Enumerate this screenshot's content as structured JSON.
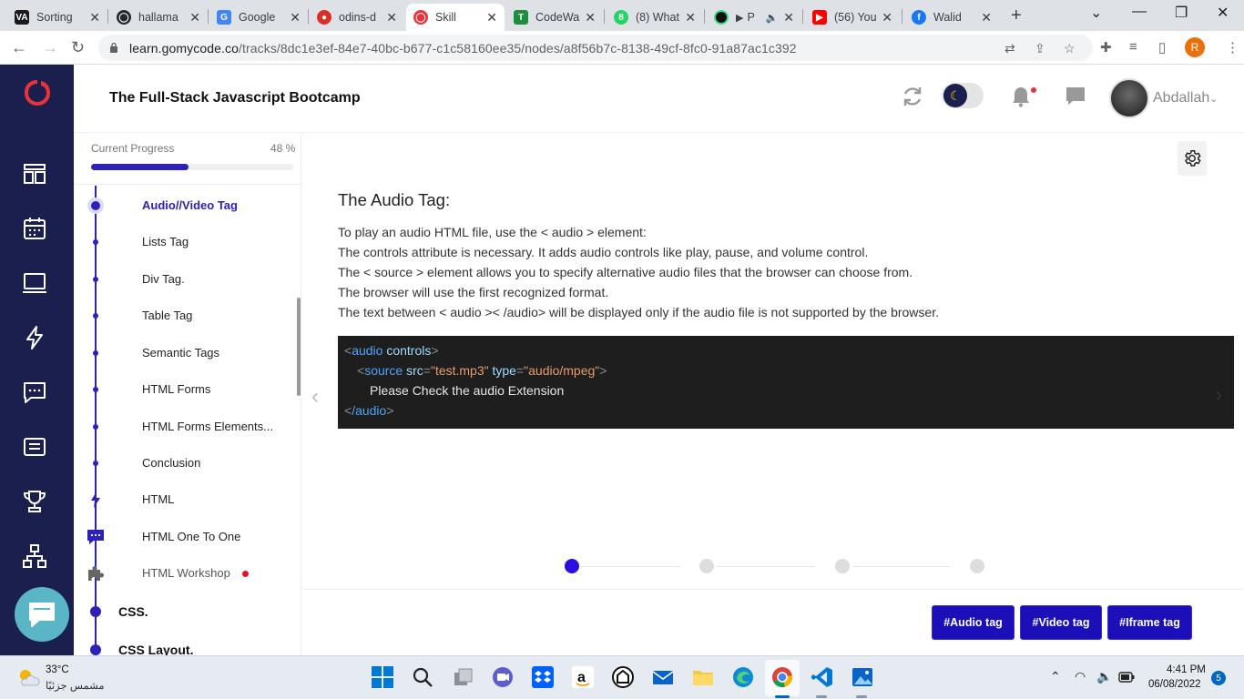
{
  "browser": {
    "tabs": [
      {
        "title": "Sorting",
        "favicon_color": "#1a1a1a",
        "favicon_glyph": "VA",
        "active": false
      },
      {
        "title": "hallama",
        "favicon_color": "#24292f",
        "favicon_glyph": "◯",
        "active": false
      },
      {
        "title": "Google",
        "favicon_color": "#4285f4",
        "favicon_glyph": "G",
        "active": false
      },
      {
        "title": "odins-d",
        "favicon_color": "#d93025",
        "favicon_glyph": "●",
        "active": false
      },
      {
        "title": "Skill",
        "favicon_color": "#e8333a",
        "favicon_glyph": "◯",
        "active": true
      },
      {
        "title": "CodeWa",
        "favicon_color": "#1e8e3e",
        "favicon_glyph": "T",
        "active": false
      },
      {
        "title": "(8) What",
        "favicon_color": "#25d366",
        "favicon_glyph": "8",
        "active": false
      },
      {
        "title": "P",
        "favicon_color": "#111111",
        "favicon_glyph": "●",
        "active": false
      },
      {
        "title": "(56) You",
        "favicon_color": "#ff0000",
        "favicon_glyph": "▶",
        "active": false
      },
      {
        "title": "Walid",
        "favicon_color": "#1877f2",
        "favicon_glyph": "f",
        "active": false
      }
    ],
    "url_host": "learn.gomycode.co",
    "url_path": "/tracks/8dc1e3ef-84e7-40bc-b677-c1c58160ee35/nodes/a8f56b7c-8138-49cf-8fc0-91a87ac1c392",
    "profile_initial": "R"
  },
  "header": {
    "title": "The Full-Stack Javascript Bootcamp",
    "username": "Abdallah"
  },
  "progress": {
    "label": "Current Progress",
    "value_text": "48 %",
    "value": 0.48
  },
  "lessons": [
    {
      "label": "Audio//Video Tag",
      "active": true
    },
    {
      "label": "Lists Tag"
    },
    {
      "label": "Div Tag."
    },
    {
      "label": "Table Tag"
    },
    {
      "label": "Semantic Tags"
    },
    {
      "label": "HTML Forms"
    },
    {
      "label": "HTML Forms Elements..."
    },
    {
      "label": "Conclusion"
    },
    {
      "label": "HTML",
      "icon": "lightning-icon"
    },
    {
      "label": "HTML One To One",
      "icon": "chat-icon"
    },
    {
      "label": "HTML Workshop",
      "icon": "puzzle-icon",
      "badge": true
    }
  ],
  "sections": [
    {
      "label": "CSS."
    },
    {
      "label": "CSS Layout."
    }
  ],
  "content": {
    "heading": "The Audio Tag:",
    "paragraphs": [
      "To play an audio HTML file, use the < audio > element:",
      "The controls attribute is necessary. It adds audio controls like play, pause, and volume control.",
      "The < source > element allows you to specify alternative audio files that the browser can choose from.",
      "The browser will use the first recognized format.",
      "The text between < audio >< /audio> will be displayed only if the audio file is not supported by the browser."
    ],
    "code": {
      "line1_tag": "audio",
      "line1_attr": "controls",
      "line2_tag": "source",
      "line2_attr1": "src",
      "line2_val1": "\"test.mp3\"",
      "line2_attr2": "type",
      "line2_val2": "\"audio/mpeg\"",
      "line3_text": "Please Check the audio Extension",
      "line4_tag": "/audio"
    },
    "steps_total": 4,
    "step_current": 1
  },
  "tag_buttons": [
    "#Audio tag",
    "#Video tag",
    "#Iframe tag"
  ],
  "taskbar": {
    "temperature": "33°C",
    "weather": "مشمس جزئيًا",
    "time": "4:41 PM",
    "date": "06/08/2022",
    "notifications": "5"
  },
  "colors": {
    "brand_navy": "#1a1f4d",
    "accent": "#2d22b8",
    "logo_red": "#e8333a"
  }
}
